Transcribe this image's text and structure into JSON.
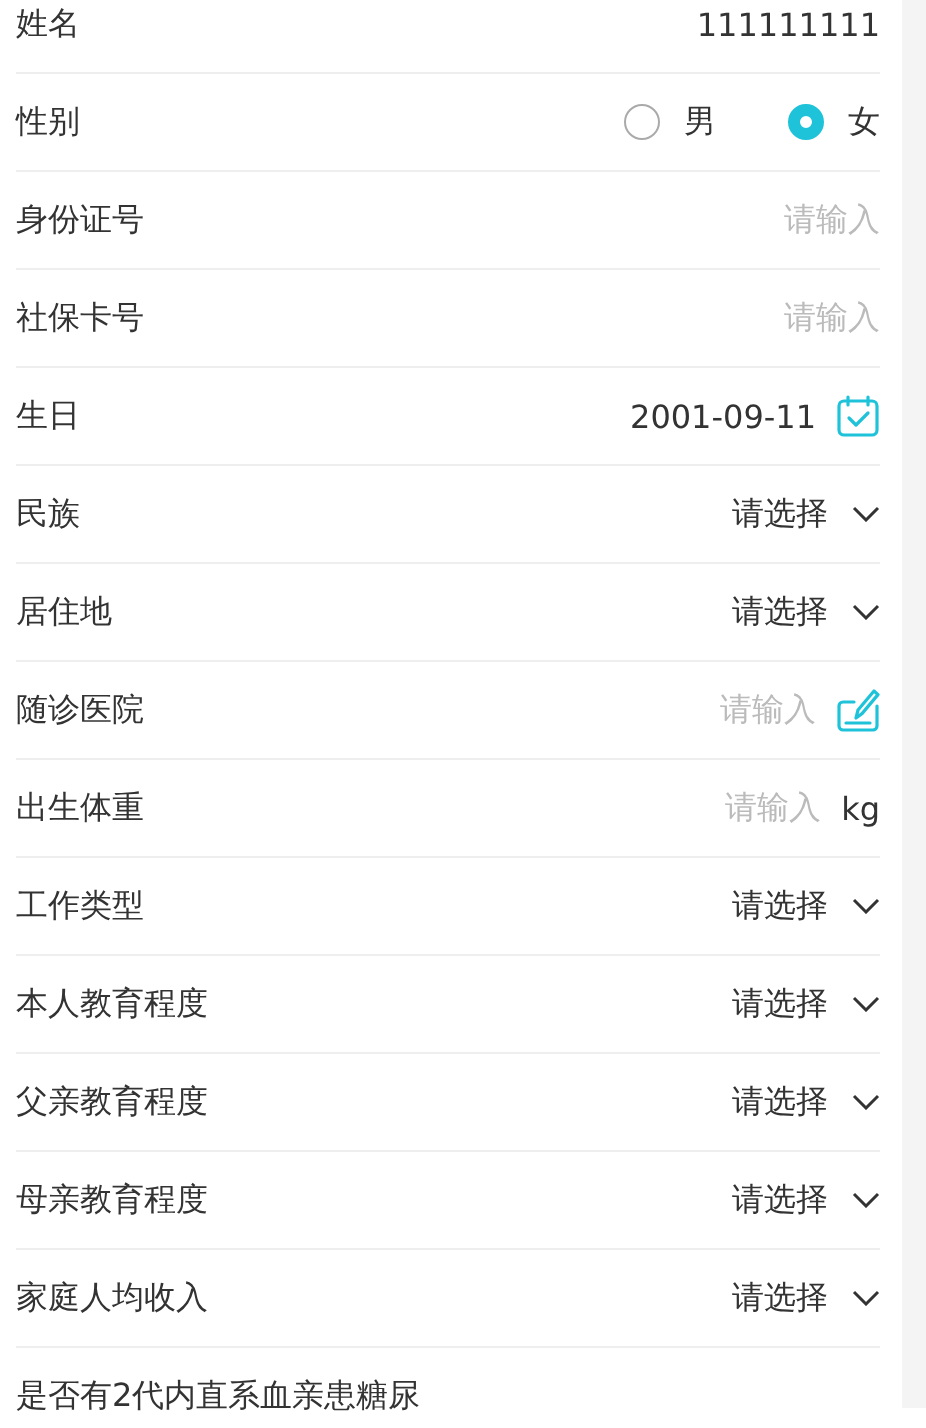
{
  "form": {
    "rows": [
      {
        "kind": "text",
        "label": "姓名",
        "value": "111111111"
      },
      {
        "kind": "radio",
        "label": "性别",
        "options": [
          {
            "label": "男",
            "selected": false
          },
          {
            "label": "女",
            "selected": true
          }
        ]
      },
      {
        "kind": "input",
        "label": "身份证号",
        "placeholder": "请输入"
      },
      {
        "kind": "input",
        "label": "社保卡号",
        "placeholder": "请输入"
      },
      {
        "kind": "date",
        "label": "生日",
        "value": "2001-09-11"
      },
      {
        "kind": "select",
        "label": "民族",
        "value": "请选择"
      },
      {
        "kind": "select",
        "label": "居住地",
        "value": "请选择"
      },
      {
        "kind": "edit",
        "label": "随诊医院",
        "placeholder": "请输入"
      },
      {
        "kind": "unit",
        "label": "出生体重",
        "placeholder": "请输入",
        "unit": "kg"
      },
      {
        "kind": "select",
        "label": "工作类型",
        "value": "请选择"
      },
      {
        "kind": "select",
        "label": "本人教育程度",
        "value": "请选择"
      },
      {
        "kind": "select",
        "label": "父亲教育程度",
        "value": "请选择"
      },
      {
        "kind": "select",
        "label": "母亲教育程度",
        "value": "请选择"
      },
      {
        "kind": "select",
        "label": "家庭人均收入",
        "value": "请选择"
      },
      {
        "kind": "text",
        "label": "是否有2代内直系血亲患糖尿"
      }
    ]
  }
}
